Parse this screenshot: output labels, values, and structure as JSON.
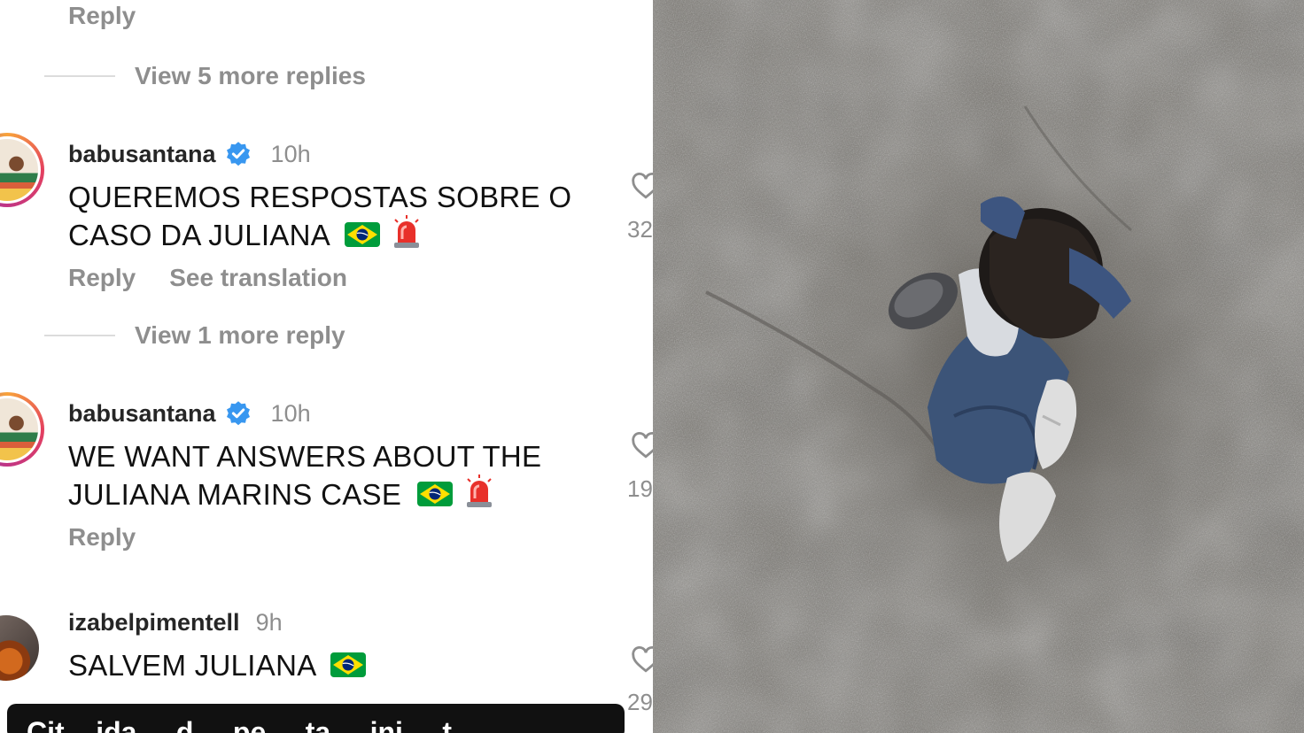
{
  "thread": {
    "top_reply_label": "Reply",
    "view_more_1": "View 5 more replies",
    "view_more_2": "View 1 more reply"
  },
  "comments": [
    {
      "username": "babusantana",
      "verified": true,
      "time": "10h",
      "text_line1": "QUEREMOS RESPOSTAS SOBRE O",
      "text_line2": "CASO DA JULIANA",
      "reply_label": "Reply",
      "translate_label": "See translation",
      "like_count": "32",
      "emojis": [
        "brazil-flag",
        "police-siren"
      ]
    },
    {
      "username": "babusantana",
      "verified": true,
      "time": "10h",
      "text_line1": "WE WANT ANSWERS ABOUT THE",
      "text_line2": "JULIANA MARINS CASE",
      "reply_label": "Reply",
      "like_count": "19",
      "emojis": [
        "brazil-flag",
        "police-siren"
      ]
    },
    {
      "username": "izabelpimentell",
      "verified": false,
      "time": "9h",
      "text_line1": "SALVEM JULIANA",
      "like_count": "29",
      "emojis": [
        "brazil-flag"
      ]
    }
  ],
  "caption_bar": {
    "text": "Cit... ida ... d ... pe ... ta ... ini ... t..."
  },
  "photo": {
    "subject": "person crouching on volcanic ground"
  },
  "colors": {
    "verified_blue": "#3897f0",
    "muted_text": "#8e8e8e",
    "brazil_green": "#009c3b",
    "brazil_yellow": "#ffdf00",
    "brazil_blue": "#002776"
  }
}
